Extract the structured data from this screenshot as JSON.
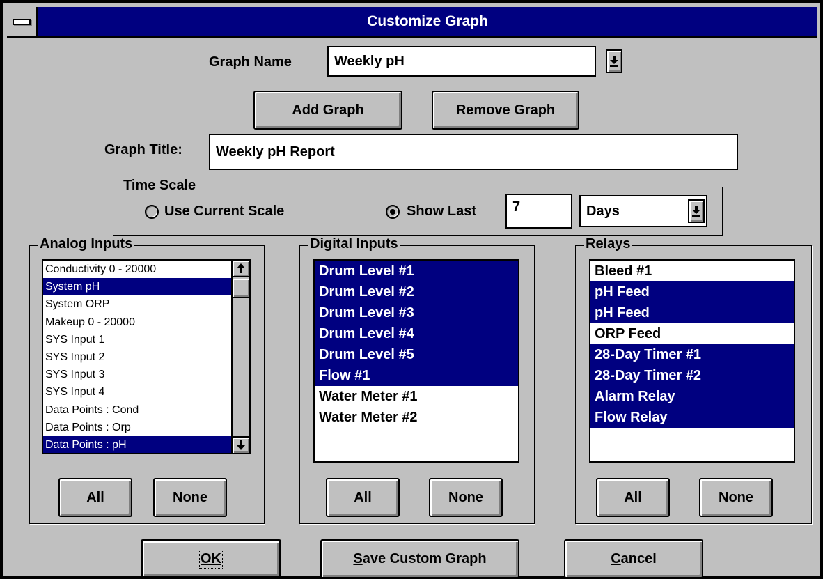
{
  "window": {
    "title": "Customize Graph"
  },
  "graph_name": {
    "label": "Graph Name",
    "value": "Weekly pH"
  },
  "buttons": {
    "add_graph": "Add Graph",
    "remove_graph": "Remove Graph"
  },
  "graph_title": {
    "label": "Graph Title:",
    "value": "Weekly pH Report"
  },
  "time_scale": {
    "title": "Time Scale",
    "use_current_label": "Use Current Scale",
    "use_current_checked": false,
    "show_last_label": "Show Last",
    "show_last_checked": true,
    "show_last_value": "7",
    "unit": "Days"
  },
  "analog": {
    "title": "Analog Inputs",
    "items": [
      {
        "label": "Conductivity  0 - 20000",
        "selected": false
      },
      {
        "label": "System pH",
        "selected": true
      },
      {
        "label": "System ORP",
        "selected": false
      },
      {
        "label": "Makeup 0 - 20000",
        "selected": false
      },
      {
        "label": "SYS Input 1",
        "selected": false
      },
      {
        "label": "SYS Input 2",
        "selected": false
      },
      {
        "label": "SYS Input 3",
        "selected": false
      },
      {
        "label": "SYS Input 4",
        "selected": false
      },
      {
        "label": "Data Points : Cond",
        "selected": false
      },
      {
        "label": "Data Points : Orp",
        "selected": false
      },
      {
        "label": "Data Points : pH",
        "selected": true
      }
    ],
    "all_label": "All",
    "none_label": "None"
  },
  "digital": {
    "title": "Digital Inputs",
    "items": [
      {
        "label": "Drum Level #1",
        "selected": true
      },
      {
        "label": "Drum Level #2",
        "selected": true
      },
      {
        "label": "Drum Level #3",
        "selected": true
      },
      {
        "label": "Drum Level #4",
        "selected": true
      },
      {
        "label": "Drum Level #5",
        "selected": true
      },
      {
        "label": "Flow #1",
        "selected": true
      },
      {
        "label": "Water Meter #1",
        "selected": false
      },
      {
        "label": "Water Meter #2",
        "selected": false
      }
    ],
    "all_label": "All",
    "none_label": "None"
  },
  "relays": {
    "title": "Relays",
    "items": [
      {
        "label": "Bleed #1",
        "selected": false
      },
      {
        "label": "pH Feed",
        "selected": true
      },
      {
        "label": "pH Feed",
        "selected": true
      },
      {
        "label": "ORP Feed",
        "selected": false
      },
      {
        "label": "28-Day Timer #1",
        "selected": true
      },
      {
        "label": "28-Day Timer #2",
        "selected": true
      },
      {
        "label": "Alarm Relay",
        "selected": true
      },
      {
        "label": "Flow Relay",
        "selected": true
      }
    ],
    "all_label": "All",
    "none_label": "None"
  },
  "footer": {
    "ok_label": "OK",
    "save_label": "Save Custom Graph",
    "cancel_label": "Cancel"
  },
  "colors": {
    "selection": "#000080",
    "titlebar": "#000080",
    "face": "#c0c0c0"
  }
}
